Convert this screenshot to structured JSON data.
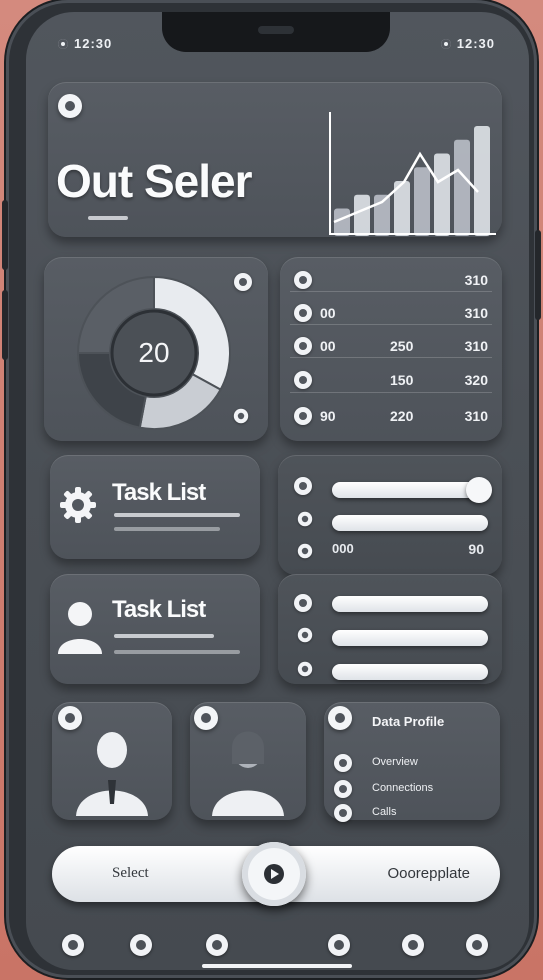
{
  "status_bar": {
    "time": "12:30",
    "indicators": "12:30"
  },
  "header": {
    "title": "Out Seler",
    "subtitle": ""
  },
  "donut": {
    "value": "20",
    "segments": [
      0.33,
      0.2,
      0.22,
      0.25
    ]
  },
  "stats_list": {
    "rows": [
      {
        "label": "",
        "v1": "",
        "v2": "310"
      },
      {
        "label": "00",
        "v1": "",
        "v2": "310"
      },
      {
        "label": "00",
        "v1": "250",
        "v2": "310"
      },
      {
        "label": "",
        "v1": "150",
        "v2": "320"
      },
      {
        "label": "90",
        "v1": "220",
        "v2": "310"
      }
    ]
  },
  "task_card_1": {
    "title": "Task List"
  },
  "task_card_2": {
    "title": "Task List"
  },
  "toggle_panel_1": {
    "rows": [
      {
        "value": 1.0
      },
      {
        "value": 0.9
      }
    ],
    "footer_left": "000",
    "footer_right": "90"
  },
  "toggle_panel_2": {
    "rows": [
      {
        "value": 0.9
      },
      {
        "value": 0.9
      },
      {
        "value": 0.9
      }
    ]
  },
  "profile_card": {
    "title": "Data Profile",
    "items": [
      "Overview",
      "Connections",
      "Calls"
    ]
  },
  "bottom_bar": {
    "left_label": "Select",
    "right_label": "Ooorepplate"
  },
  "mini_chart": {
    "type": "bar",
    "values": [
      2,
      3,
      3,
      4,
      5,
      6,
      7,
      8
    ]
  },
  "colors": {
    "screen": "#4c5157",
    "accent": "#f3f5f7",
    "background": "#cd7c6f"
  }
}
